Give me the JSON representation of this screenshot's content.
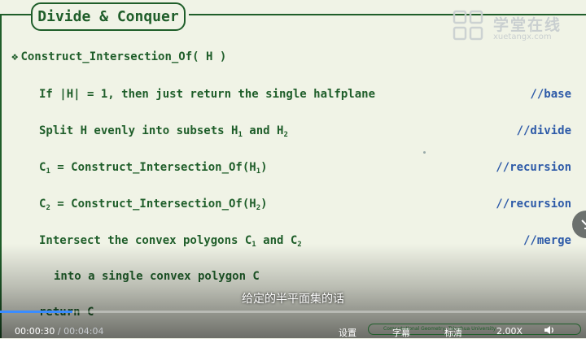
{
  "slide": {
    "title": "Divide & Conquer",
    "heading_bullet": "❖",
    "heading": "Construct_Intersection_Of( H )",
    "logo": {
      "text": "学堂在线",
      "sub": "xuetangx.com"
    },
    "lines": [
      {
        "code": "If |H| = 1, then just return the single halfplane",
        "comment": "//base"
      },
      {
        "code_pre": "Split H evenly into subsets H",
        "sub1": "1",
        "code_mid": " and H",
        "sub2": "2",
        "comment": "//divide"
      },
      {
        "a": "C",
        "a_sub": "1",
        "b": " = Construct_Intersection_Of(H",
        "b_sub": "1",
        "c": ")",
        "comment": "//recursion"
      },
      {
        "a": "C",
        "a_sub": "2",
        "b": " = Construct_Intersection_Of(H",
        "b_sub": "2",
        "c": ")",
        "comment": "//recursion"
      },
      {
        "a": "Intersect the convex polygons C",
        "a_sub": "1",
        "b": " and C",
        "b_sub": "2",
        "comment": "//merge"
      },
      {
        "code": "into a single convex polygon C"
      },
      {
        "code": "return C"
      }
    ],
    "footer_text": "Computational Geometry, Tsinghua University"
  },
  "player": {
    "subtitle": "给定的半平面集的话",
    "current_time": "00:00:30",
    "separator": " / ",
    "duration": "00:04:04",
    "progress": 0.123,
    "settings_label": "设置",
    "captions_label": "字幕",
    "quality_label": "标清",
    "speed_label": "2.00X",
    "accent_color": "#3a8cff"
  }
}
